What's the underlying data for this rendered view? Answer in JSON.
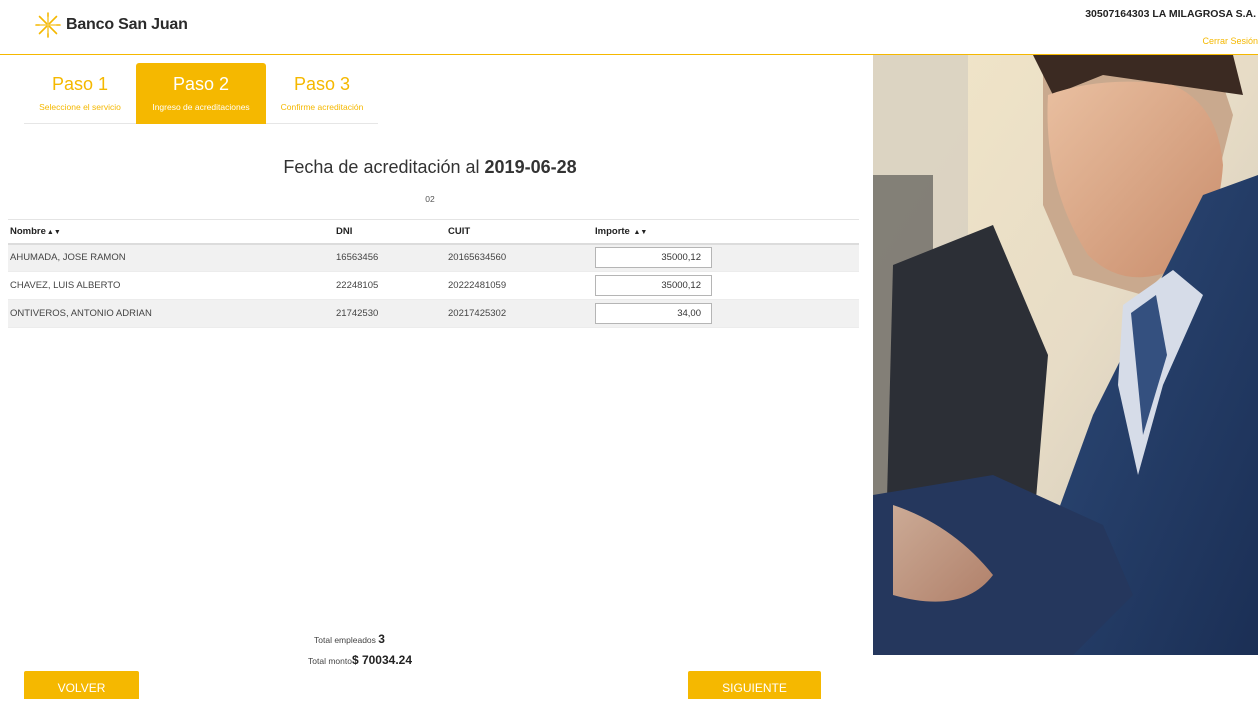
{
  "header": {
    "bank_name": "Banco San Juan",
    "user": "30507164303 LA MILAGROSA S.A.",
    "logout": "Cerrar Sesión"
  },
  "steps": [
    {
      "title": "Paso 1",
      "subtitle": "Seleccione el servicio"
    },
    {
      "title": "Paso 2",
      "subtitle": "Ingreso de acreditaciones"
    },
    {
      "title": "Paso 3",
      "subtitle": "Confirme acreditación"
    }
  ],
  "date": {
    "label": "Fecha de acreditación al",
    "value": "2019-06-28",
    "sub": "02"
  },
  "table": {
    "headers": {
      "nombre": "Nombre",
      "dni": "DNI",
      "cuit": "CUIT",
      "importe": "Importe"
    },
    "rows": [
      {
        "nombre": "AHUMADA, JOSE RAMON",
        "dni": "16563456",
        "cuit": "20165634560",
        "importe": "35000,12"
      },
      {
        "nombre": "CHAVEZ, LUIS ALBERTO",
        "dni": "22248105",
        "cuit": "20222481059",
        "importe": "35000,12"
      },
      {
        "nombre": "ONTIVEROS, ANTONIO ADRIAN",
        "dni": "21742530",
        "cuit": "20217425302",
        "importe": "34,00"
      }
    ]
  },
  "totals": {
    "empleados_label": "Total empleados",
    "empleados_value": "3",
    "monto_label": "Total monto",
    "monto_value": "$ 70034.24"
  },
  "buttons": {
    "back": "VOLVER",
    "next": "SIGUIENTE"
  },
  "colors": {
    "accent": "#f5b800"
  }
}
